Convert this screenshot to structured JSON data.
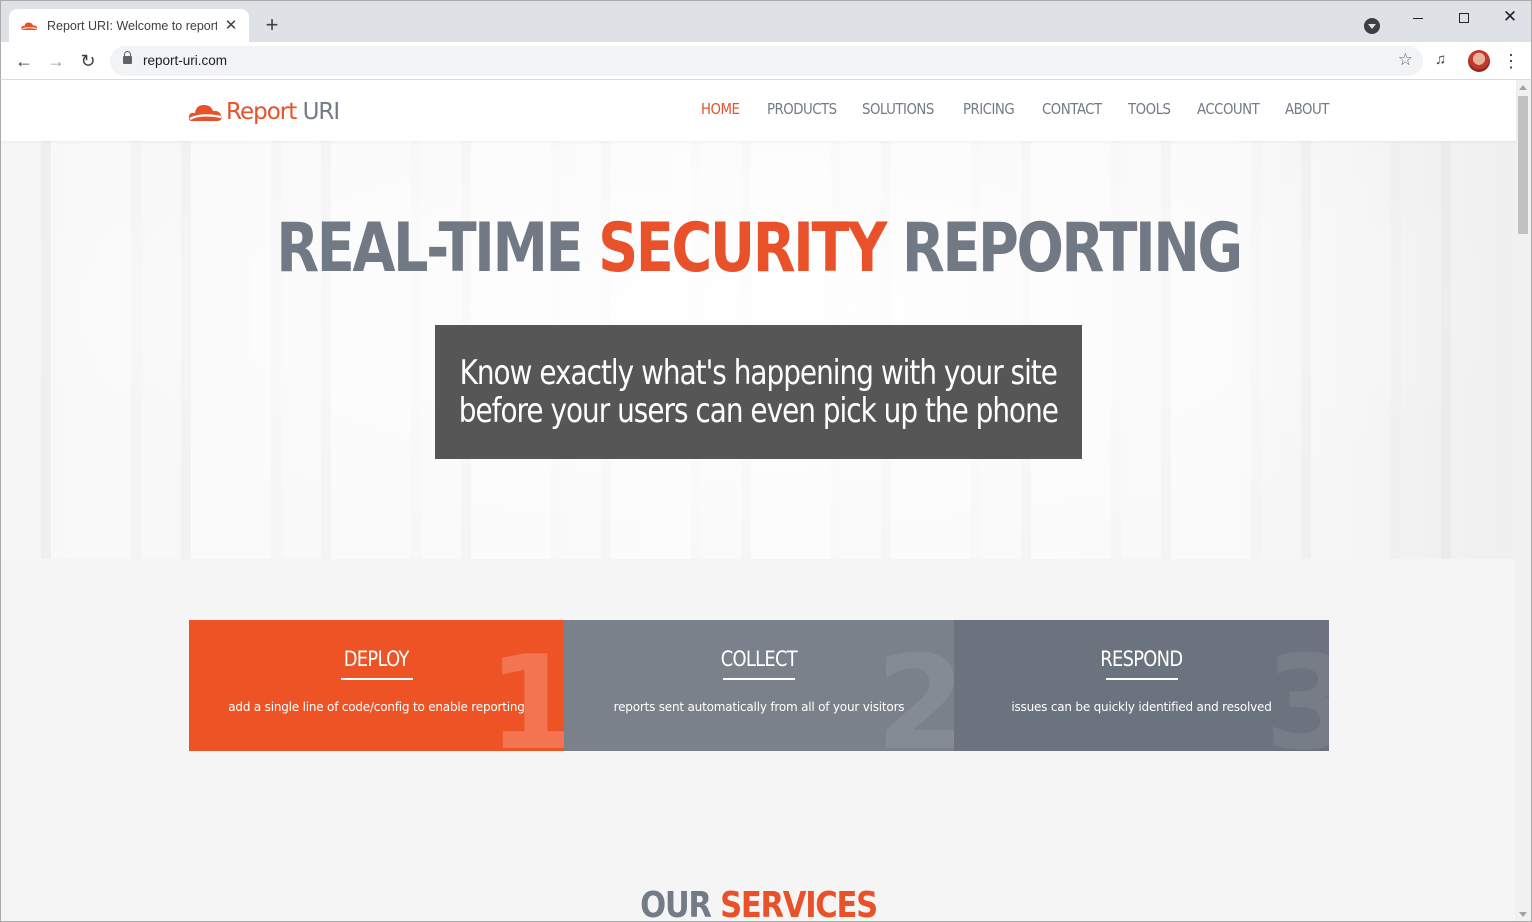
{
  "browser": {
    "tab_title": "Report URI: Welcome to report-u",
    "url": "report-uri.com",
    "new_tab": "+",
    "close_tab": "✕",
    "minimize": "",
    "maximize": "",
    "close_window": "✕"
  },
  "site": {
    "logo_report": "Report",
    "logo_uri": "URI",
    "nav": [
      {
        "label": "HOME",
        "active": true
      },
      {
        "label": "PRODUCTS"
      },
      {
        "label": "SOLUTIONS"
      },
      {
        "label": "PRICING"
      },
      {
        "label": "CONTACT"
      },
      {
        "label": "TOOLS"
      },
      {
        "label": "ACCOUNT"
      },
      {
        "label": "ABOUT"
      }
    ],
    "colors": {
      "accent": "#e8512a",
      "gray": "#737b86"
    }
  },
  "hero": {
    "title_part1": "REAL-TIME",
    "title_accent": "SECURITY",
    "title_part2": "REPORTING",
    "line1": "Know exactly what's happening with your site",
    "line2": "before your users can even pick up the phone"
  },
  "steps": [
    {
      "number": "1",
      "title": "DEPLOY",
      "desc": "add a single line of code/config to enable reporting"
    },
    {
      "number": "2",
      "title": "COLLECT",
      "desc": "reports sent automatically from all of your visitors"
    },
    {
      "number": "3",
      "title": "RESPOND",
      "desc": "issues can be quickly identified and resolved"
    }
  ],
  "services": {
    "part1": "OUR",
    "accent": "SERVICES"
  }
}
